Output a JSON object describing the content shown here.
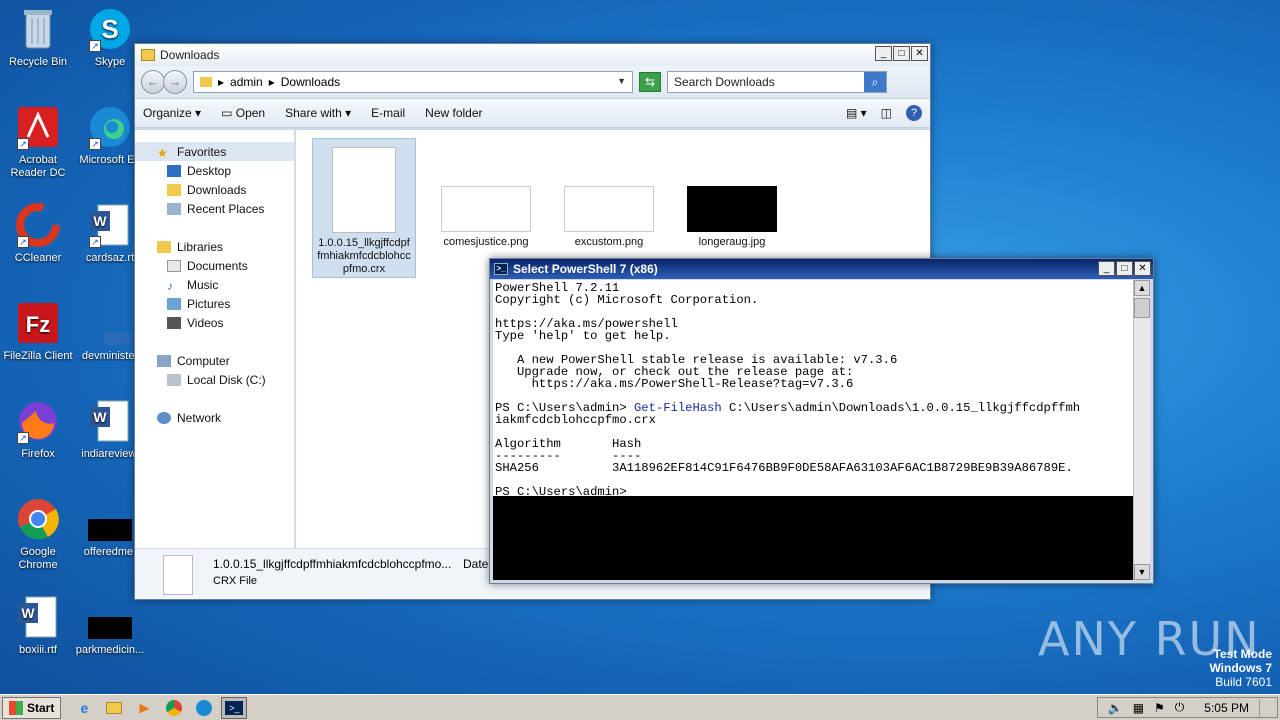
{
  "desktop": {
    "icons": [
      {
        "label": "Recycle Bin"
      },
      {
        "label": "Skype"
      },
      {
        "label": "Acrobat Reader DC"
      },
      {
        "label": "Microsoft Ed"
      },
      {
        "label": "CCleaner"
      },
      {
        "label": "cardsaz.rt"
      },
      {
        "label": "FileZilla Client"
      },
      {
        "label": "devminister"
      },
      {
        "label": "Firefox"
      },
      {
        "label": "indiareview."
      },
      {
        "label": "Google Chrome"
      },
      {
        "label": "offeredme."
      },
      {
        "label": "boxiii.rtf"
      },
      {
        "label": "parkmedicin..."
      }
    ]
  },
  "explorer": {
    "title": "Downloads",
    "breadcrumb": [
      "admin",
      "Downloads"
    ],
    "search_placeholder": "Search Downloads",
    "toolbar": {
      "organize": "Organize",
      "open": "Open",
      "share": "Share with",
      "email": "E-mail",
      "new_folder": "New folder"
    },
    "nav": {
      "favorites": "Favorites",
      "desktop": "Desktop",
      "downloads": "Downloads",
      "recent": "Recent Places",
      "libraries": "Libraries",
      "documents": "Documents",
      "music": "Music",
      "pictures": "Pictures",
      "videos": "Videos",
      "computer": "Computer",
      "local_disk": "Local Disk (C:)",
      "network": "Network"
    },
    "files": [
      {
        "name": "1.0.0.15_llkgjffcdpffmhiakmfcdcblohccpfmo.crx"
      },
      {
        "name": "comesjustice.png"
      },
      {
        "name": "excustom.png"
      },
      {
        "name": "longeraug.jpg"
      }
    ],
    "details": {
      "name": "1.0.0.15_llkgjffcdpffmhiakmfcdcblohccpfmo...",
      "date_label": "Date",
      "type": "CRX File"
    }
  },
  "powershell": {
    "title": "Select PowerShell 7 (x86)",
    "lines": [
      "PowerShell 7.2.11",
      "Copyright (c) Microsoft Corporation.",
      "",
      "https://aka.ms/powershell",
      "Type 'help' to get help.",
      "",
      "   A new PowerShell stable release is available: v7.3.6",
      "   Upgrade now, or check out the release page at:",
      "     https://aka.ms/PowerShell-Release?tag=v7.3.6",
      ""
    ],
    "prompt1": "PS C:\\Users\\admin> ",
    "command": "Get-FileHash",
    "args1": " C:\\Users\\admin\\Downloads\\1.0.0.15_llkgjffcdpffmh",
    "args2": "iakmfcdcblohccpfmo.crx",
    "col_algorithm": "Algorithm",
    "col_hash": "Hash",
    "sep": "---------       ----",
    "algorithm": "SHA256",
    "hash": "3A118962EF814C91F6476BB9F0DE58AFA63103AF6AC1B8729BE9B39A86789E.",
    "prompt2": "PS C:\\Users\\admin> "
  },
  "taskbar": {
    "start": "Start",
    "time": "5:05 PM"
  },
  "watermark": {
    "line1": "Test Mode",
    "line2": "Windows 7",
    "line3": "Build 7601",
    "brand": "ANY RUN"
  }
}
